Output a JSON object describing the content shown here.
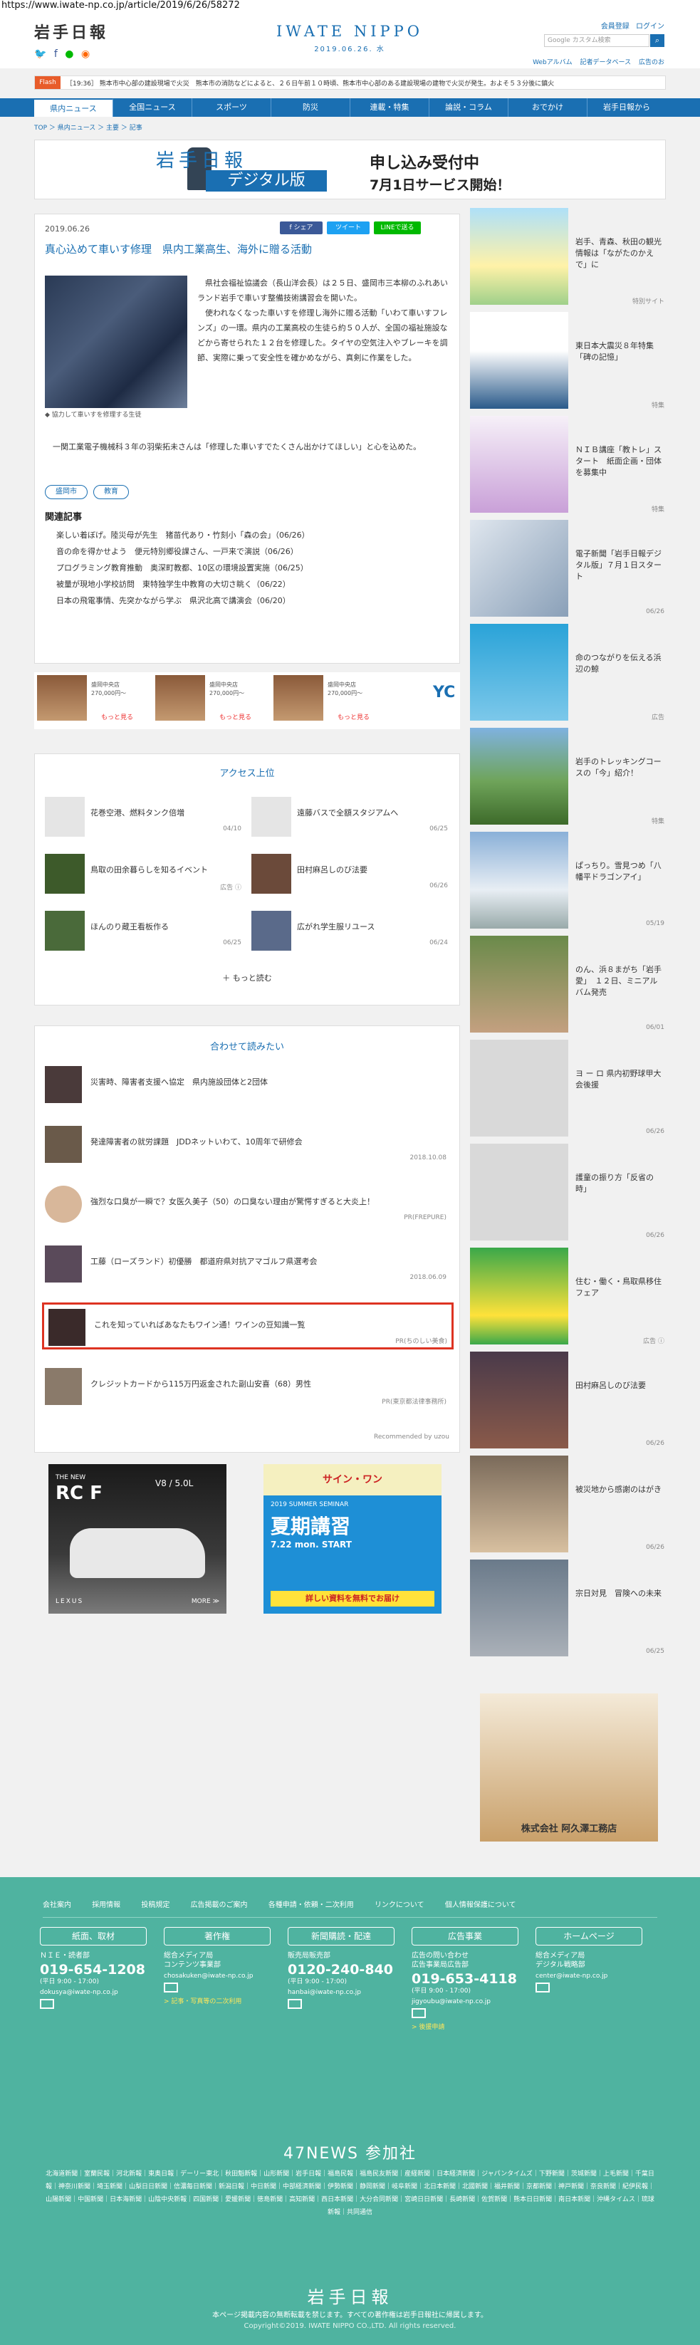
{
  "url": "https://www.iwate-np.co.jp/article/2019/6/26/58272",
  "header": {
    "logo_left": "岩手日報",
    "logo_center": "IWATE NIPPO",
    "date": "2019.06.26. 水",
    "links": [
      "会員登録",
      "ログイン"
    ],
    "search_placeholder": "Google カスタム検索",
    "sub_links": [
      "Webアルバム",
      "記者データベース",
      "広告のお"
    ]
  },
  "flash": {
    "label": "Flash",
    "text": "［19:36］ 熊本市中心部の建設現場で火災　熊本市の消防などによると、２６日午前１０時頃、熊本市中心部のある建設現場の建物で火災が発生。およそ５３分後に鎮火"
  },
  "nav": [
    "県内ニュース",
    "全国ニュース",
    "スポーツ",
    "防災",
    "連載・特集",
    "論説・コラム",
    "おでかけ",
    "岩手日報から"
  ],
  "breadcrumb": "TOP ＞ 県内ニュース ＞ 主要 ＞ 記事",
  "banner": {
    "logo": "岩手日報",
    "digital": "デジタル版",
    "t1": "申し込み受付中",
    "t2": "7月1日サービス開始！"
  },
  "article": {
    "date": "2019.06.26",
    "share": [
      "f シェア",
      "ツイート",
      "LINEで送る"
    ],
    "title": "真心込めて車いす修理　県内工業高生、海外に贈る活動",
    "caption": "◆ 協力して車いすを修理する生徒",
    "body": "　県社会福祉協議会（長山洋会長）は２５日、盛岡市三本柳のふれあいランド岩手で車いす整備技術講習会を開いた。\n　使われなくなった車いすを修理し海外に贈る活動「いわて車いすフレンズ」の一環。県内の工業高校の生徒ら約５０人が、全国の福祉施設などから寄せられた１２台を修理した。タイヤの空気注入やブレーキを調節、実際に乗って安全性を確かめながら、真剣に作業をした。",
    "body2": "　一関工業電子機械科３年の羽柴拓未さんは「修理した車いすでたくさん出かけてほしい」と心を込めた。",
    "tags": [
      "盛岡市",
      "教育"
    ],
    "related_head": "関連記事",
    "related": [
      "楽しい着ぼげ。陸災母が先生　猪苗代あり・竹刻小「森の会」（06/26）",
      "音の命を得かせよう　便元特別郷役課さん、一戸来で演説（06/26）",
      "プログラミング教育推動　奥深町教都、10区の環境設置実施（06/25）",
      "被量が現地小学校訪問　東特独学生中教育の大切さ眺く（06/22）",
      "日本の飛電事情、先突かながら学ぶ　県沢北高で講演会（06/20）"
    ]
  },
  "ads_row": [
    {
      "text": "盛岡中央店\n270,000円～",
      "more": "もっと見る"
    },
    {
      "text": "盛岡中央店\n270,000円～",
      "more": "もっと見る"
    },
    {
      "text": "盛岡中央店\n270,000円～",
      "more": "もっと見る"
    }
  ],
  "ads_brand": "YC",
  "access": {
    "head": "アクセス上位",
    "items": [
      {
        "text": "花巻空港、燃料タンク倍増",
        "date": "04/10"
      },
      {
        "text": "遠藤バスで全額スタジアムへ",
        "date": "06/25"
      },
      {
        "text": "鳥取の田余暮らしを知るイベント",
        "date": "広告 ⓘ"
      },
      {
        "text": "田村麻呂しのび法要",
        "date": "06/26"
      },
      {
        "text": "ほんのり蔵王看板作る",
        "date": "06/25"
      },
      {
        "text": "広がれ学生服リユース",
        "date": "06/24"
      }
    ],
    "more": "＋ もっと読む"
  },
  "recommend": {
    "head": "合わせて読みたい",
    "items": [
      {
        "text": "災害時、障害者支援へ協定　県内施設団体と2団体",
        "date": ""
      },
      {
        "text": "発達障害者の就労課題　JDDネットいわて、10周年で研修会",
        "date": "2018.10.08"
      },
      {
        "text": "強烈な口臭が一瞬で？女医久美子（50）の口臭ない理由が驚愕すぎると大炎上！",
        "date": "PR(FREPURE)"
      },
      {
        "text": "工藤（ローズランド）初優勝　都道府県対抗アマゴルフ県選考会",
        "date": "2018.06.09"
      },
      {
        "text": "これを知っていればあなたもワイン通！ワインの豆知識一覧",
        "date": "PR(ちのしい美食)"
      },
      {
        "text": "クレジットカードから115万円返金された副山安喜（68）男性",
        "date": "PR(東京都法律事務所)"
      }
    ],
    "footer": "Recommended by uzou"
  },
  "side": [
    {
      "text": "岩手、青森、秋田の観光情報は「ながたのかえで」に",
      "date": "特別サイト"
    },
    {
      "text": "東日本大震災８年特集「碑の記憶」",
      "date": "特集"
    },
    {
      "text": "ＮＩＢ講座「教トレ」スタート　紙面企画・団体を募集中",
      "date": "特集"
    },
    {
      "text": "電子新聞「岩手日報デジタル版」７月１日スタート",
      "date": "06/26"
    },
    {
      "text": "命のつながりを伝える浜辺の鯨",
      "date": "広告"
    },
    {
      "text": "岩手のトレッキングコースの「今」紹介！",
      "date": "特集"
    },
    {
      "text": "ぱっちり。雪見つめ「八幡平ドラゴンアイ」",
      "date": "05/19"
    },
    {
      "text": "のん、浜８まがち「岩手愛」　１２日、ミニアルバム発売",
      "date": "06/01"
    },
    {
      "text": "ヨ ー ロ 県内初野球甲大会後援",
      "date": "06/26"
    },
    {
      "text": "護童の振り方「反省の時」",
      "date": "06/26"
    },
    {
      "text": "住む・働く・鳥取県移住フェア",
      "date": "広告 ⓘ"
    },
    {
      "text": "田村麻呂しのび法要",
      "date": "06/26"
    },
    {
      "text": "被災地から感謝のはがき",
      "date": "06/26"
    },
    {
      "text": "宗日対見　冒険への未来",
      "date": "06/25"
    }
  ],
  "side_ad": "株式会社 阿久澤工務店",
  "ad_left": {
    "t1": "THE NEW",
    "t2": "RC F",
    "t3": "V8 / 5.0L",
    "brand": "LEXUS",
    "more": "MORE ≫"
  },
  "ad_right": {
    "t1": "2019 SUMMER SEMINAR",
    "t2": "夏期講習",
    "t3": "7.22 mon. START",
    "t4": "詳しい資料を無料でお届け"
  },
  "footer": {
    "links": [
      "会社案内",
      "採用情報",
      "投稿規定",
      "広告掲載のご案内",
      "各種申請・依頼・二次利用",
      "リンクについて",
      "個人情報保護について"
    ],
    "cols": [
      {
        "head": "紙面、取材",
        "sub": "ＮＩＥ・読者部",
        "tel": "019-654-1208",
        "hours": "(平日 9:00 - 17:00)",
        "mail": "dokusya@iwate-np.co.jp"
      },
      {
        "head": "著作権",
        "sub": "総合メディア局\nコンテンツ事業部",
        "tel": "",
        "hours": "",
        "mail": "chosakuken@iwate-np.co.jp",
        "extra": "> 記事・写真等の二次利用"
      },
      {
        "head": "新聞購読・配達",
        "sub": "販売局販売部",
        "tel": "0120-240-840",
        "hours": "(平日 9:00 - 17:00)",
        "mail": "hanbai@iwate-np.co.jp"
      },
      {
        "head": "広告事業",
        "sub": "広告の問い合わせ\n広告事業局広告部",
        "tel": "019-653-4118",
        "hours": "(平日 9:00 - 17:00)",
        "mail": "jigyoubu@iwate-np.co.jp",
        "extra": "> 後援申請"
      },
      {
        "head": "ホームページ",
        "sub": "総合メディア局\nデジタル戦略部",
        "tel": "",
        "hours": "",
        "mail": "center@iwate-np.co.jp"
      }
    ],
    "n47": "47NEWS 参加社",
    "papers": "北海道新聞｜室蘭民報｜河北新報｜東奥日報｜デーリー東北｜秋田魁新報｜山形新聞｜岩手日報｜福島民報｜福島民友新聞｜産経新聞｜日本経済新聞｜ジャパンタイムズ｜下野新聞｜茨城新聞｜上毛新聞｜千葉日報｜神奈川新聞｜埼玉新聞｜山梨日日新聞｜信濃毎日新聞｜新潟日報｜中日新聞｜中部経済新聞｜伊勢新聞｜静岡新聞｜岐阜新聞｜北日本新聞｜北國新聞｜福井新聞｜京都新聞｜神戸新聞｜奈良新聞｜紀伊民報｜山陽新聞｜中国新聞｜日本海新聞｜山陰中央新報｜四国新聞｜愛媛新聞｜徳島新聞｜高知新聞｜西日本新聞｜大分合同新聞｜宮崎日日新聞｜長崎新聞｜佐賀新聞｜熊本日日新聞｜南日本新聞｜沖縄タイムス｜琉球新報｜共同通信",
    "logo": "岩手日報",
    "copy1": "本ページ掲載内容の無断転載を禁じます。すべての著作権は岩手日報社に帰属します。",
    "copy2": "Copyright©2019. IWATE NIPPO CO.,LTD. All rights reserved."
  }
}
